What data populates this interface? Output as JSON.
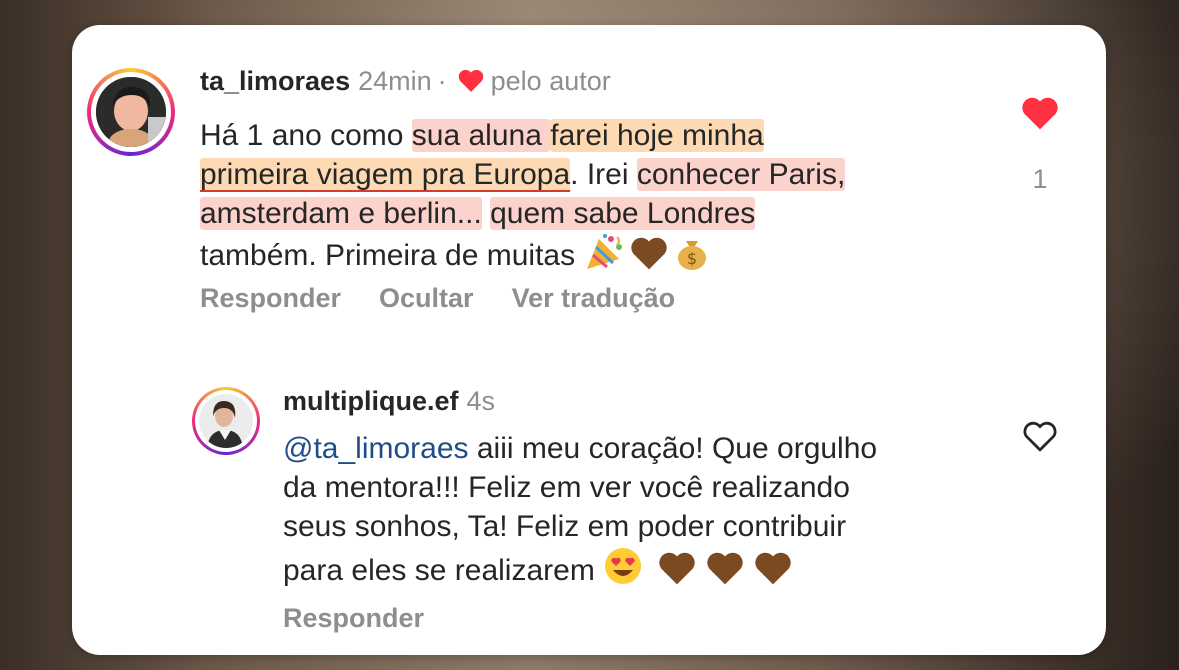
{
  "comment": {
    "username": "ta_limoraes",
    "time": "24min",
    "separator": "·",
    "liked_by_author": "pelo autor",
    "lines": {
      "l1a": "Há 1 ano como ",
      "l1b": "sua aluna ",
      "l1c": "farei hoje minha",
      "l2a": "primeira viagem pra Europa",
      "l2b": ". Irei ",
      "l2c": "conhecer Paris,",
      "l3a": "amsterdam e berlin...",
      "l3b": " ",
      "l3c": "quem sabe Londres",
      "l4a": "também. Primeira de muitas "
    },
    "emojis": [
      "party-popper",
      "brown-heart",
      "money-bag"
    ],
    "like_count": "1",
    "like_state": "liked",
    "actions": [
      "Responder",
      "Ocultar",
      "Ver tradução"
    ]
  },
  "reply": {
    "username": "multiplique.ef",
    "time": "4s",
    "mention": "@ta_limoraes",
    "lines": {
      "l1": " aiii meu coração! Que orgulho",
      "l2": "da mentora!!! Feliz em ver você realizando",
      "l3": "seus sonhos, Ta! Feliz em poder contribuir",
      "l4": "para eles se realizarem "
    },
    "emojis": [
      "heart-eyes",
      "brown-heart",
      "brown-heart",
      "brown-heart"
    ],
    "like_state": "not-liked",
    "actions": [
      "Responder"
    ]
  },
  "colors": {
    "like_red": "#ff3040",
    "text": "#262626",
    "muted": "#8e8e8e",
    "mention": "#1f4d8a",
    "highlight": "#fcc48c"
  }
}
